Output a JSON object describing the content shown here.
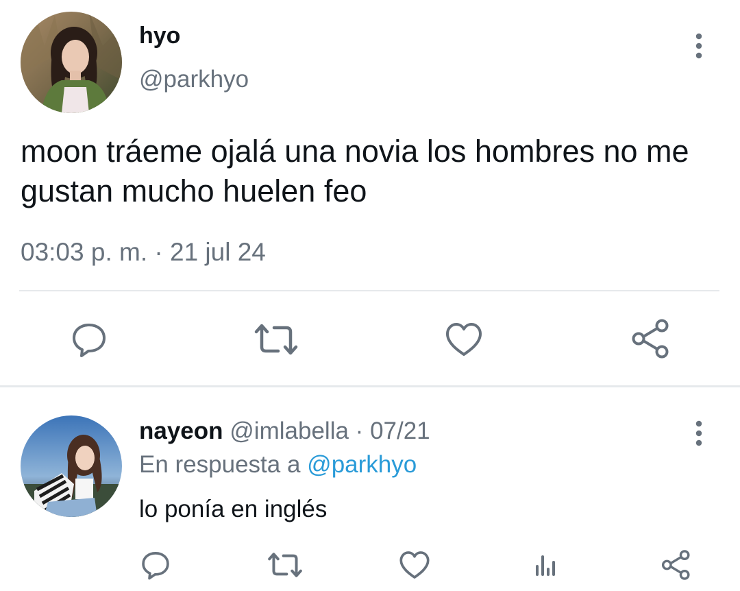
{
  "main_tweet": {
    "display_name": "hyo",
    "handle": "@parkhyo",
    "text": "moon tráeme ojalá una novia los hombres no me gustan mucho huelen feo",
    "timestamp": "03:03 p. m. · 21 jul 24",
    "avatar_icon": "avatar-photo",
    "more_icon": "more-vertical-icon",
    "actions": [
      "reply-icon",
      "retweet-icon",
      "like-icon",
      "share-icon"
    ]
  },
  "reply_tweet": {
    "display_name": "nayeon",
    "handle": "@imlabella",
    "separator": "·",
    "date": "07/21",
    "reply_prefix": "En respuesta a",
    "reply_to": "@parkhyo",
    "text": "lo ponía en inglés",
    "avatar_icon": "avatar-photo",
    "more_icon": "more-vertical-icon",
    "actions": [
      "reply-icon",
      "retweet-icon",
      "like-icon",
      "analytics-icon",
      "share-icon"
    ]
  },
  "colors": {
    "text": "#0f1419",
    "muted": "#67717c",
    "link": "#2a9bd8",
    "icon": "#67717c",
    "divider": "#e6e9ec"
  }
}
